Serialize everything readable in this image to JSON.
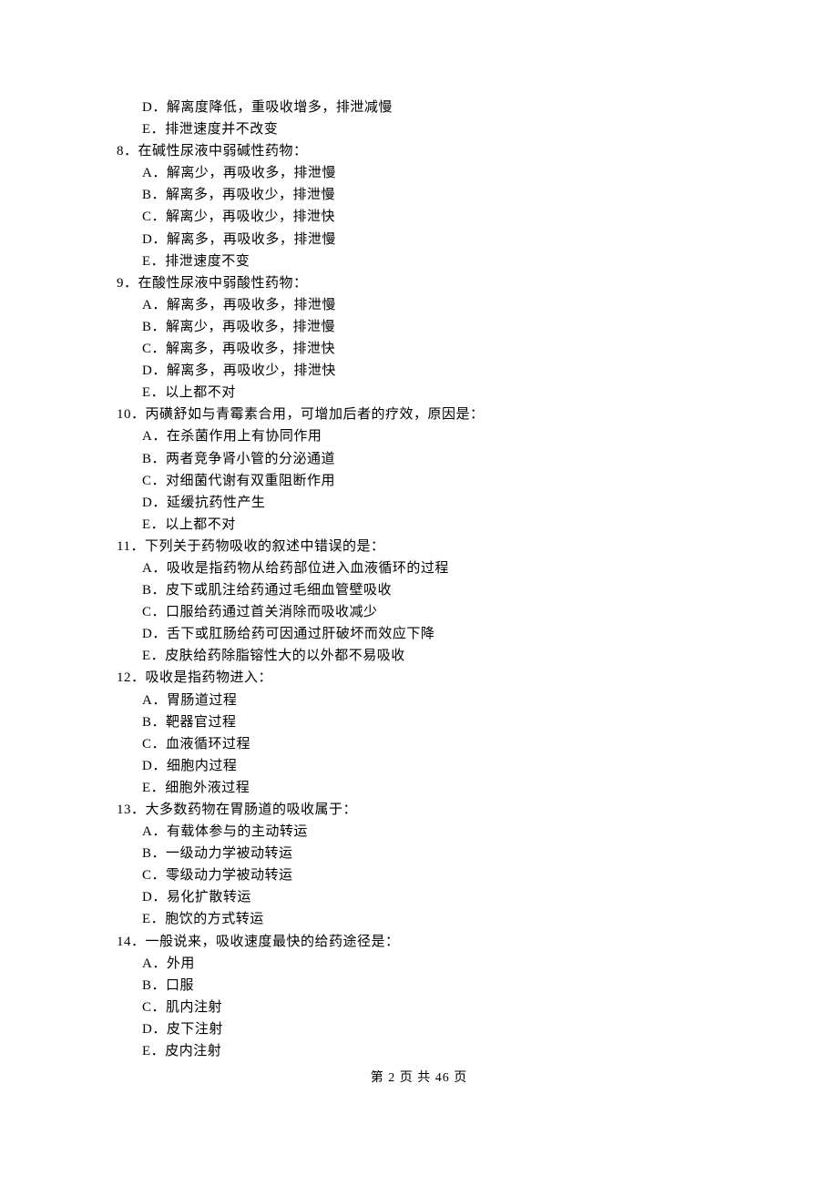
{
  "partial_question_7": {
    "options_tail": [
      {
        "label": "D",
        "text": "解离度降低，重吸收增多，排泄减慢"
      },
      {
        "label": "E",
        "text": "排泄速度并不改变"
      }
    ]
  },
  "questions": [
    {
      "number": "8",
      "text": "在碱性尿液中弱碱性药物：",
      "options": [
        {
          "label": "A",
          "text": "解离少，再吸收多，排泄慢"
        },
        {
          "label": "B",
          "text": "解离多，再吸收少，排泄慢"
        },
        {
          "label": "C",
          "text": "解离少，再吸收少，排泄快"
        },
        {
          "label": "D",
          "text": "解离多，再吸收多，排泄慢"
        },
        {
          "label": "E",
          "text": "排泄速度不变"
        }
      ]
    },
    {
      "number": "9",
      "text": "在酸性尿液中弱酸性药物：",
      "options": [
        {
          "label": "A",
          "text": "解离多，再吸收多，排泄慢"
        },
        {
          "label": "B",
          "text": "解离少，再吸收多，排泄慢"
        },
        {
          "label": "C",
          "text": "解离多，再吸收多，排泄快"
        },
        {
          "label": "D",
          "text": "解离多，再吸收少，排泄快"
        },
        {
          "label": "E",
          "text": "以上都不对"
        }
      ]
    },
    {
      "number": "10",
      "text": "丙磺舒如与青霉素合用，可增加后者的疗效，原因是：",
      "options": [
        {
          "label": "A",
          "text": "在杀菌作用上有协同作用"
        },
        {
          "label": "B",
          "text": "两者竞争肾小管的分泌通道"
        },
        {
          "label": "C",
          "text": "对细菌代谢有双重阻断作用"
        },
        {
          "label": "D",
          "text": "延缓抗药性产生"
        },
        {
          "label": "E",
          "text": "以上都不对"
        }
      ]
    },
    {
      "number": "11",
      "text": "下列关于药物吸收的叙述中错误的是：",
      "options": [
        {
          "label": "A",
          "text": "吸收是指药物从给药部位进入血液循环的过程"
        },
        {
          "label": "B",
          "text": "皮下或肌注给药通过毛细血管壁吸收"
        },
        {
          "label": "C",
          "text": "口服给药通过首关消除而吸收减少"
        },
        {
          "label": "D",
          "text": "舌下或肛肠给药可因通过肝破坏而效应下降"
        },
        {
          "label": "E",
          "text": "皮肤给药除脂镕性大的以外都不易吸收"
        }
      ]
    },
    {
      "number": "12",
      "text": "吸收是指药物进入：",
      "options": [
        {
          "label": "A",
          "text": "胃肠道过程"
        },
        {
          "label": "B",
          "text": "靶器官过程"
        },
        {
          "label": "C",
          "text": "血液循环过程"
        },
        {
          "label": "D",
          "text": "细胞内过程"
        },
        {
          "label": "E",
          "text": "细胞外液过程"
        }
      ]
    },
    {
      "number": "13",
      "text": "大多数药物在胃肠道的吸收属于：",
      "options": [
        {
          "label": "A",
          "text": "有载体参与的主动转运"
        },
        {
          "label": "B",
          "text": "一级动力学被动转运"
        },
        {
          "label": "C",
          "text": "零级动力学被动转运"
        },
        {
          "label": "D",
          "text": "易化扩散转运"
        },
        {
          "label": "E",
          "text": "胞饮的方式转运"
        }
      ]
    },
    {
      "number": "14",
      "text": "一般说来，吸收速度最快的给药途径是：",
      "options": [
        {
          "label": "A",
          "text": "外用"
        },
        {
          "label": "B",
          "text": "口服"
        },
        {
          "label": "C",
          "text": "肌内注射"
        },
        {
          "label": "D",
          "text": "皮下注射"
        },
        {
          "label": "E",
          "text": "皮内注射"
        }
      ]
    }
  ],
  "footer": {
    "text": "第 2 页 共 46 页"
  }
}
